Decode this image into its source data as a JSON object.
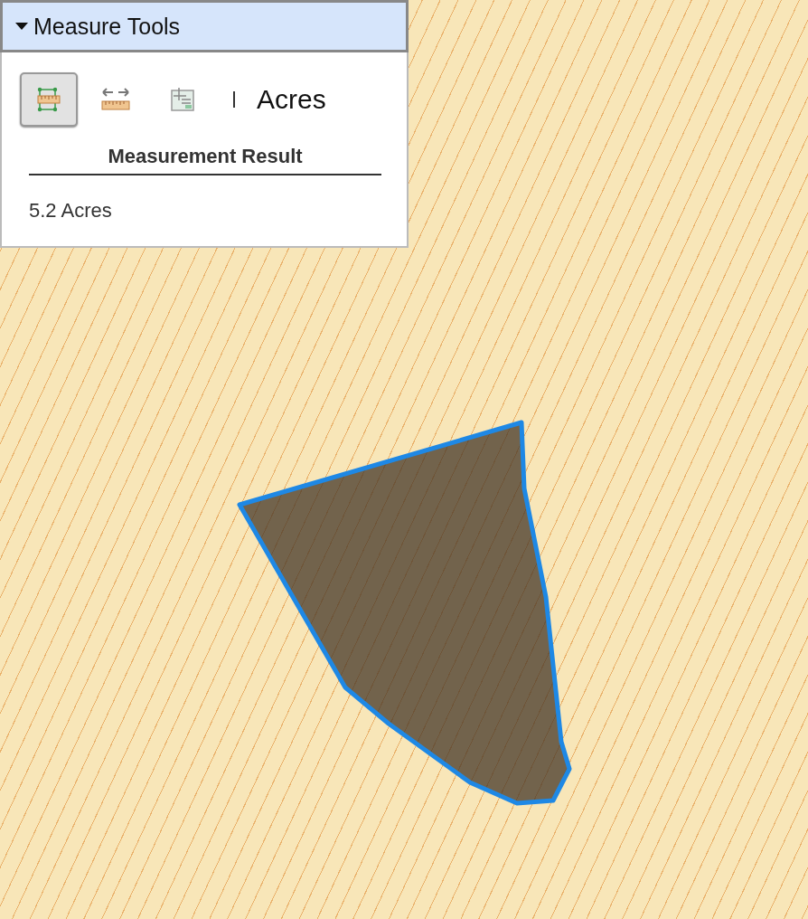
{
  "measure_panel": {
    "title": "Measure Tools",
    "expanded": true,
    "tools": [
      {
        "kind": "area",
        "selected": true
      },
      {
        "kind": "distance",
        "selected": false
      },
      {
        "kind": "location",
        "selected": false
      }
    ],
    "unit": "Acres",
    "result_heading": "Measurement Result",
    "result_value": "5.2 Acres"
  }
}
